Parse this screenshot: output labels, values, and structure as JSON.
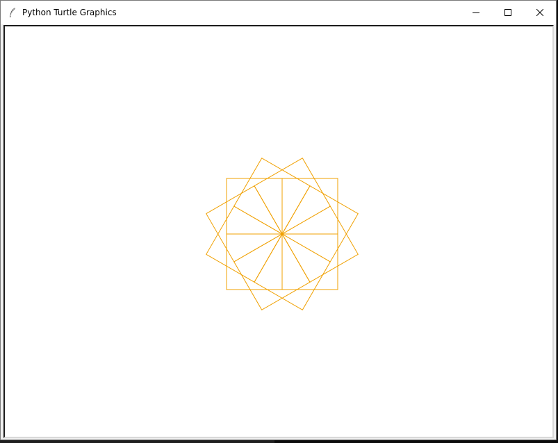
{
  "window": {
    "title": "Python Turtle Graphics",
    "icons": {
      "app": "feather-icon",
      "minimize": "minimize-icon",
      "maximize": "maximize-icon",
      "close": "close-icon"
    }
  },
  "drawing": {
    "pen_color": "#f0a000",
    "background_color": "#ffffff",
    "shape": "square",
    "square_count": 12,
    "rotation_step_degrees": 30,
    "line_width": 1
  }
}
